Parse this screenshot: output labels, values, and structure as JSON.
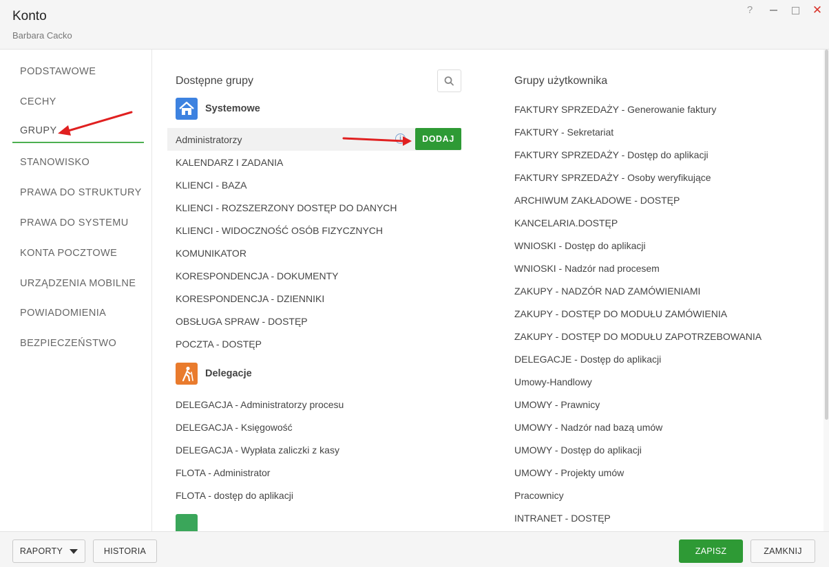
{
  "window": {
    "title": "Konto",
    "subtitle": "Barbara Cacko",
    "help": "?",
    "close": "✕"
  },
  "sidebar": {
    "items": [
      {
        "label": "PODSTAWOWE"
      },
      {
        "label": "CECHY"
      },
      {
        "label": "GRUPY",
        "active": true
      },
      {
        "label": "STANOWISKO"
      },
      {
        "label": "PRAWA DO STRUKTURY"
      },
      {
        "label": "PRAWA DO SYSTEMU"
      },
      {
        "label": "KONTA POCZTOWE"
      },
      {
        "label": "URZĄDZENIA MOBILNE"
      },
      {
        "label": "POWIADOMIENIA"
      },
      {
        "label": "BEZPIECZEŃSTWO"
      }
    ]
  },
  "available": {
    "title": "Dostępne grupy",
    "search_icon": "search-icon",
    "categories": [
      {
        "label": "Systemowe",
        "icon": "home-icon",
        "color": "#3d82e0",
        "items": [
          "Administratorzy",
          "KALENDARZ I ZADANIA",
          "KLIENCI - BAZA",
          "KLIENCI - ROZSZERZONY DOSTĘP DO DANYCH",
          "KLIENCI - WIDOCZNOŚĆ OSÓB FIZYCZNYCH",
          "KOMUNIKATOR",
          "KORESPONDENCJA - DOKUMENTY",
          "KORESPONDENCJA - DZIENNIKI",
          "OBSŁUGA SPRAW - DOSTĘP",
          "POCZTA - DOSTĘP"
        ]
      },
      {
        "label": "Delegacje",
        "icon": "traveler-icon",
        "color": "#e97b2d",
        "items": [
          "DELEGACJA - Administratorzy procesu",
          "DELEGACJA - Księgowość",
          "DELEGACJA - Wypłata zaliczki z kasy",
          "FLOTA - Administrator",
          "FLOTA - dostęp do aplikacji"
        ]
      }
    ],
    "hovered_row": {
      "info": "i",
      "add_label": "DODAJ"
    }
  },
  "user_groups": {
    "title": "Grupy użytkownika",
    "items": [
      "FAKTURY SPRZEDAŻY - Generowanie faktury",
      "FAKTURY - Sekretariat",
      "FAKTURY SPRZEDAŻY - Dostęp do aplikacji",
      "FAKTURY SPRZEDAŻY - Osoby weryfikujące",
      "ARCHIWUM ZAKŁADOWE - DOSTĘP",
      "KANCELARIA.DOSTĘP",
      "WNIOSKI - Dostęp do aplikacji",
      "WNIOSKI - Nadzór nad procesem",
      "ZAKUPY - NADZÓR NAD ZAMÓWIENIAMI",
      "ZAKUPY - DOSTĘP DO MODUŁU ZAMÓWIENIA",
      "ZAKUPY - DOSTĘP DO MODUŁU ZAPOTRZEBOWANIA",
      "DELEGACJE - Dostęp do aplikacji",
      "Umowy-Handlowy",
      "UMOWY - Prawnicy",
      "UMOWY - Nadzór nad bazą umów",
      "UMOWY - Dostęp do aplikacji",
      "UMOWY - Projekty umów",
      "Pracownicy",
      "INTRANET - DOSTĘP"
    ]
  },
  "footer": {
    "reports_label": "RAPORTY",
    "history_label": "HISTORIA",
    "save_label": "ZAPISZ",
    "close_label": "ZAMKNIJ"
  },
  "colors": {
    "accent_green": "#2e9a35",
    "annotation_red": "#e02020"
  }
}
